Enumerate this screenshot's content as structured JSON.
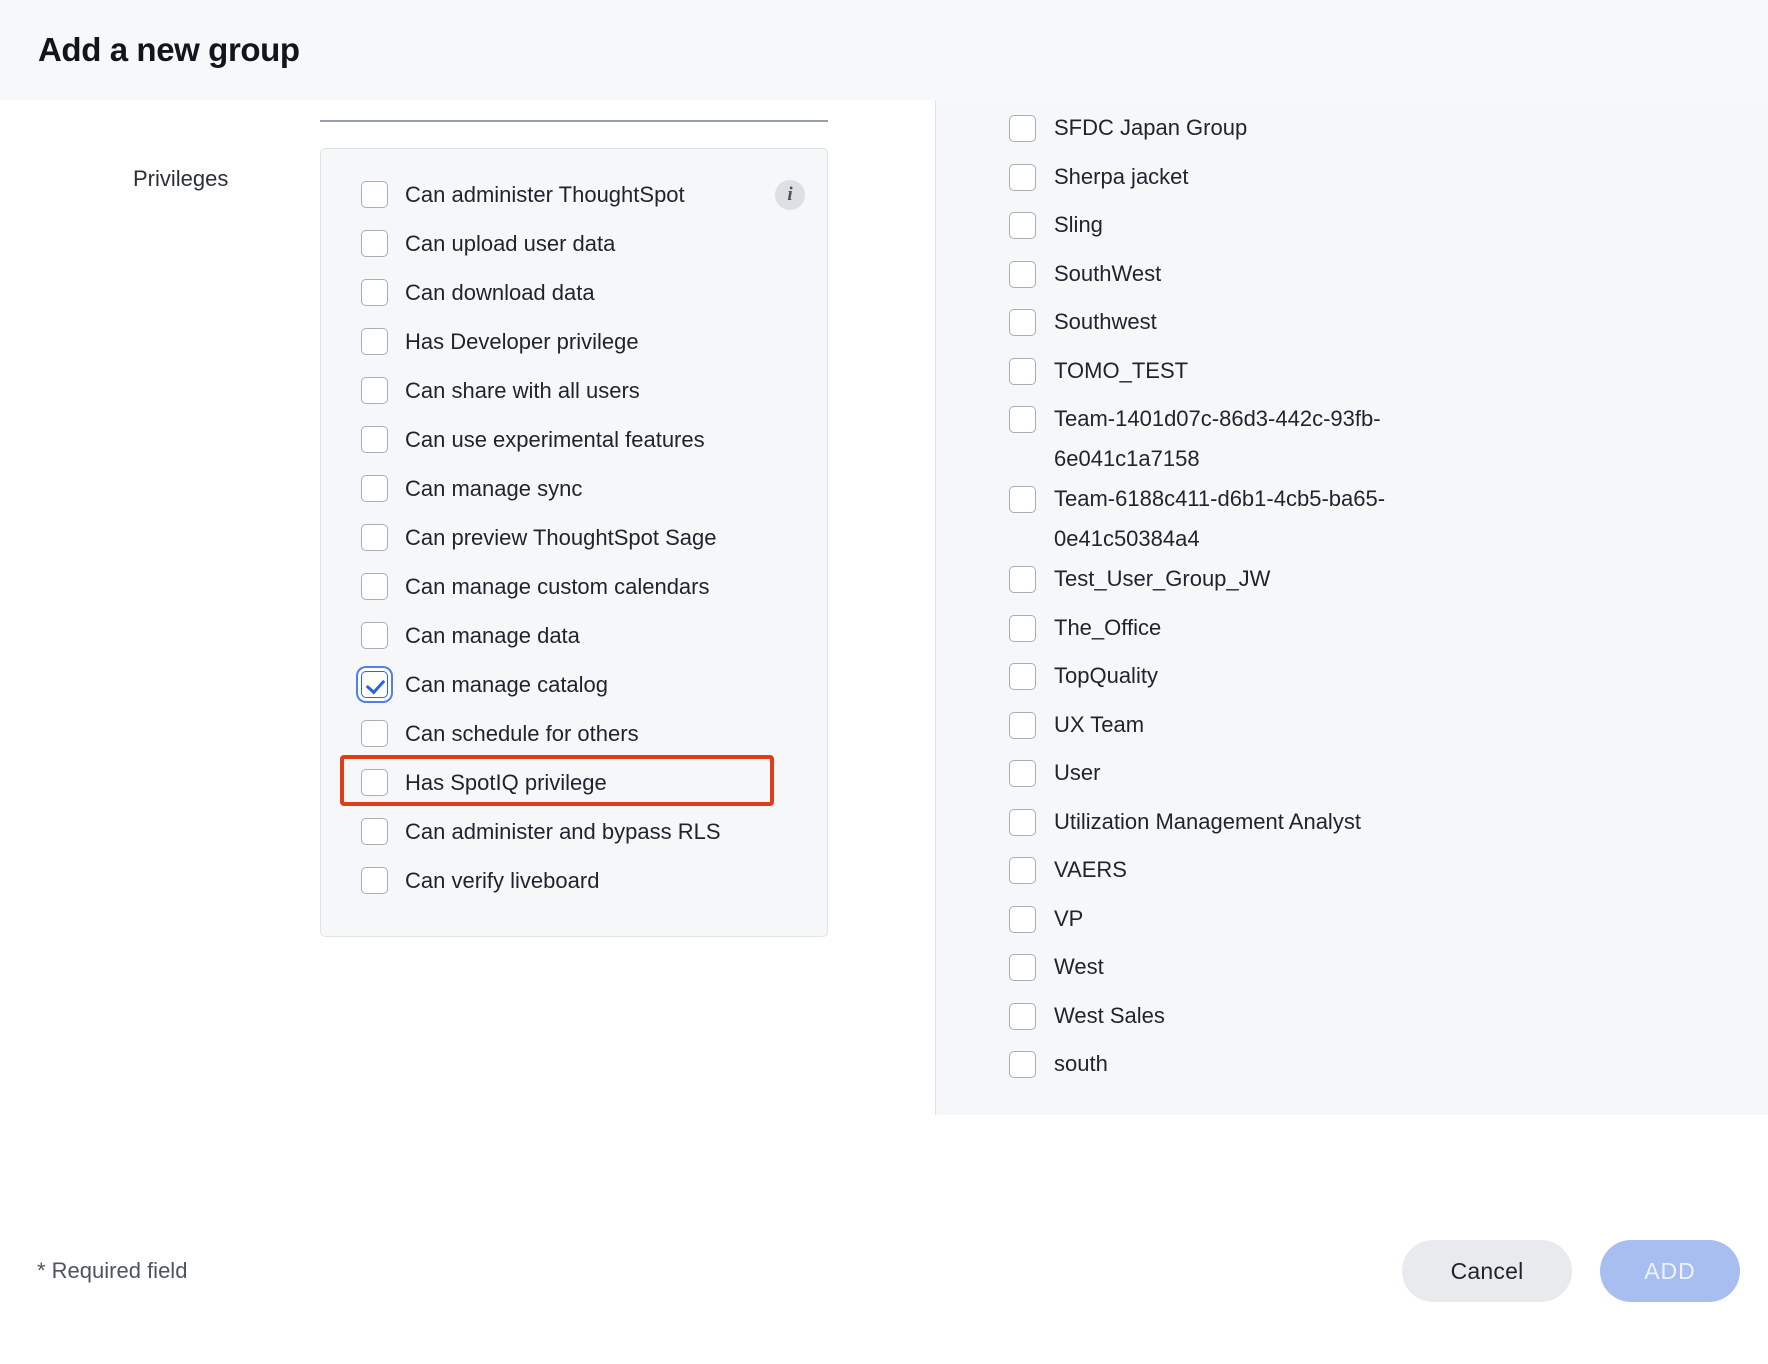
{
  "dialog": {
    "title": "Add a new group",
    "required_note": "* Required field"
  },
  "form": {
    "privileges_label": "Privileges",
    "privileges": [
      {
        "label": "Can administer ThoughtSpot",
        "checked": false,
        "info": "i"
      },
      {
        "label": "Can upload user data",
        "checked": false
      },
      {
        "label": "Can download data",
        "checked": false
      },
      {
        "label": "Has Developer privilege",
        "checked": false
      },
      {
        "label": "Can share with all users",
        "checked": false
      },
      {
        "label": "Can use experimental features",
        "checked": false
      },
      {
        "label": "Can manage sync",
        "checked": false
      },
      {
        "label": "Can preview ThoughtSpot Sage",
        "checked": false
      },
      {
        "label": "Can manage custom calendars",
        "checked": false
      },
      {
        "label": "Can manage data",
        "checked": false
      },
      {
        "label": "Can manage catalog",
        "checked": true,
        "highlighted": true
      },
      {
        "label": "Can schedule for others",
        "checked": false
      },
      {
        "label": "Has SpotIQ privilege",
        "checked": false
      },
      {
        "label": "Can administer and bypass RLS",
        "checked": false
      },
      {
        "label": "Can verify liveboard",
        "checked": false
      }
    ]
  },
  "groups_panel": {
    "items": [
      {
        "label": "SFDC Japan Group",
        "checked": false
      },
      {
        "label": "Sherpa jacket",
        "checked": false
      },
      {
        "label": "Sling",
        "checked": false
      },
      {
        "label": "SouthWest",
        "checked": false
      },
      {
        "label": "Southwest",
        "checked": false
      },
      {
        "label": "TOMO_TEST",
        "checked": false
      },
      {
        "label": "Team-1401d07c-86d3-442c-93fb-6e041c1a7158",
        "checked": false
      },
      {
        "label": "Team-6188c411-d6b1-4cb5-ba65-0e41c50384a4",
        "checked": false
      },
      {
        "label": "Test_User_Group_JW",
        "checked": false
      },
      {
        "label": "The_Office",
        "checked": false
      },
      {
        "label": "TopQuality",
        "checked": false
      },
      {
        "label": "UX Team",
        "checked": false
      },
      {
        "label": "User",
        "checked": false
      },
      {
        "label": "Utilization Management Analyst",
        "checked": false
      },
      {
        "label": "VAERS",
        "checked": false
      },
      {
        "label": "VP",
        "checked": false
      },
      {
        "label": "West",
        "checked": false
      },
      {
        "label": "West Sales",
        "checked": false
      },
      {
        "label": "south",
        "checked": false
      }
    ]
  },
  "footer": {
    "cancel_label": "Cancel",
    "add_label": "ADD"
  },
  "colors": {
    "highlight": "#e03c1c",
    "checkbox_accent": "#2a64e0",
    "add_button": "#a8bdf0",
    "panel_bg": "#f5f7f9"
  }
}
